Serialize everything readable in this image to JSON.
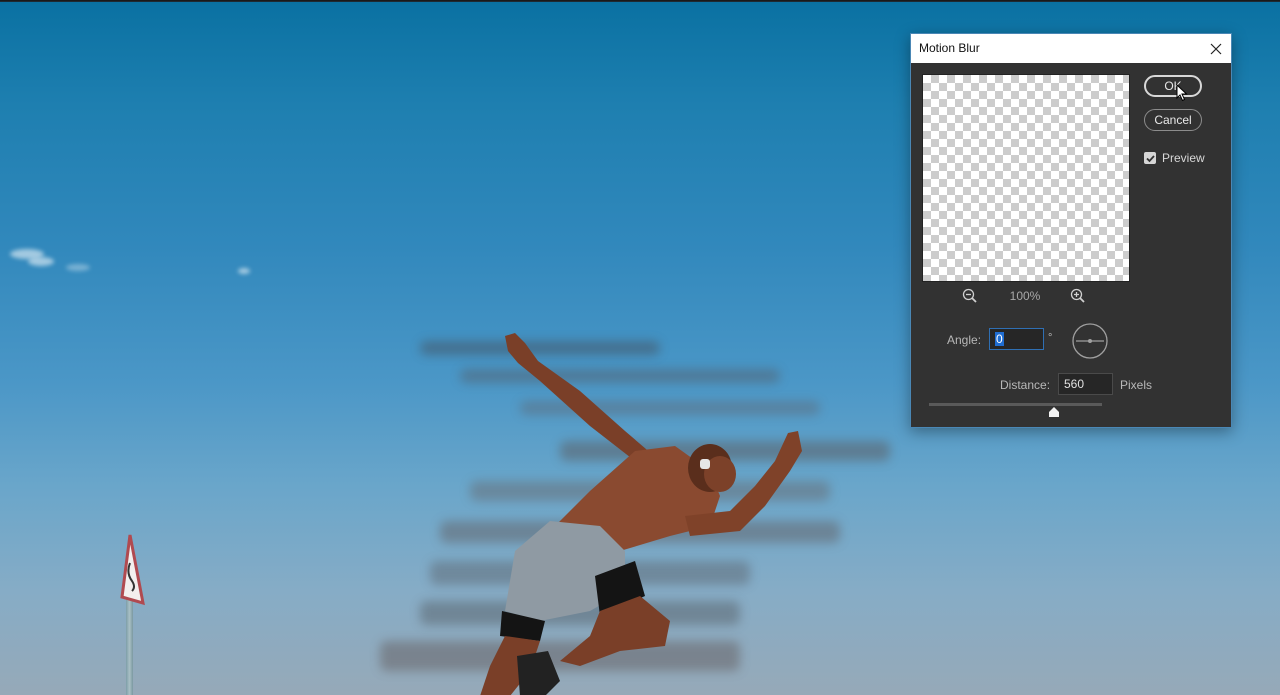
{
  "dialog": {
    "title": "Motion Blur",
    "ok_label": "OK",
    "cancel_label": "Cancel",
    "preview_label": "Preview",
    "preview_checked": true,
    "zoom_level": "100%",
    "angle_label": "Angle:",
    "angle_value": "0",
    "angle_unit": "°",
    "distance_label": "Distance:",
    "distance_value": "560",
    "distance_unit": "Pixels",
    "distance_slider_fraction": 0.72
  },
  "icons": {
    "close": "close-icon",
    "zoom_out": "zoom-out-icon",
    "zoom_in": "zoom-in-icon",
    "checkbox": "checkmark-icon",
    "angle_dial": "angle-dial-icon",
    "slider_thumb": "slider-thumb-icon",
    "cursor": "mouse-pointer-icon"
  },
  "colors": {
    "dialog_bg": "#323232",
    "dialog_border": "#4a87b5",
    "selection": "#1f6dd2",
    "sky_top": "#0a71a2",
    "sky_bottom": "#96a9b8"
  }
}
